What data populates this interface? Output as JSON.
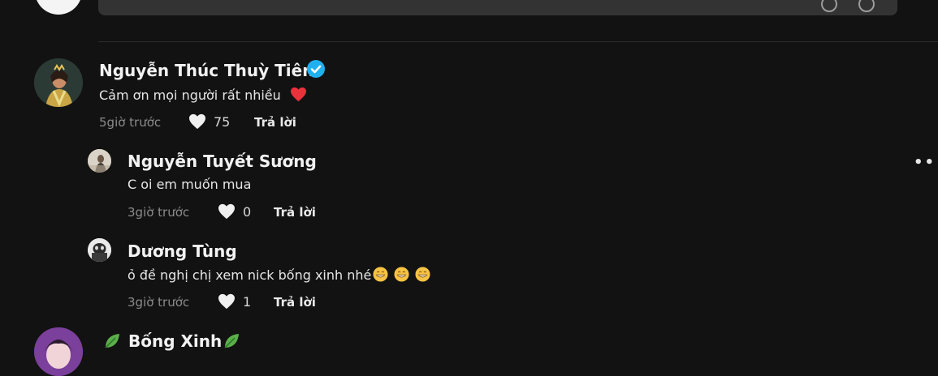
{
  "comments": [
    {
      "name": "Nguyễn Thúc Thuỳ Tiên",
      "text": "Cảm ơn mọi người rất nhiều",
      "time": "5giờ trước",
      "likes": "75",
      "reply": "Trả lời",
      "verified": true
    },
    {
      "name": "Nguyễn Tuyết Sương",
      "text": "C oi em muốn mua",
      "time": "3giờ trước",
      "likes": "0",
      "reply": "Trả lời"
    },
    {
      "name": "Dương Tùng",
      "text": "ỏ đề nghị chị xem nick bống xinh nhé",
      "time": "3giờ trước",
      "likes": "1",
      "reply": "Trả lời"
    },
    {
      "name": "Bống Xinh"
    }
  ],
  "colors": {
    "background": "#121212",
    "verified": "#20b0f0",
    "heart_red": "#e8323c"
  },
  "icons": [
    "heart-icon",
    "verified-badge-icon",
    "grinning-emoji-icon",
    "leaf-icon",
    "more-icon"
  ]
}
